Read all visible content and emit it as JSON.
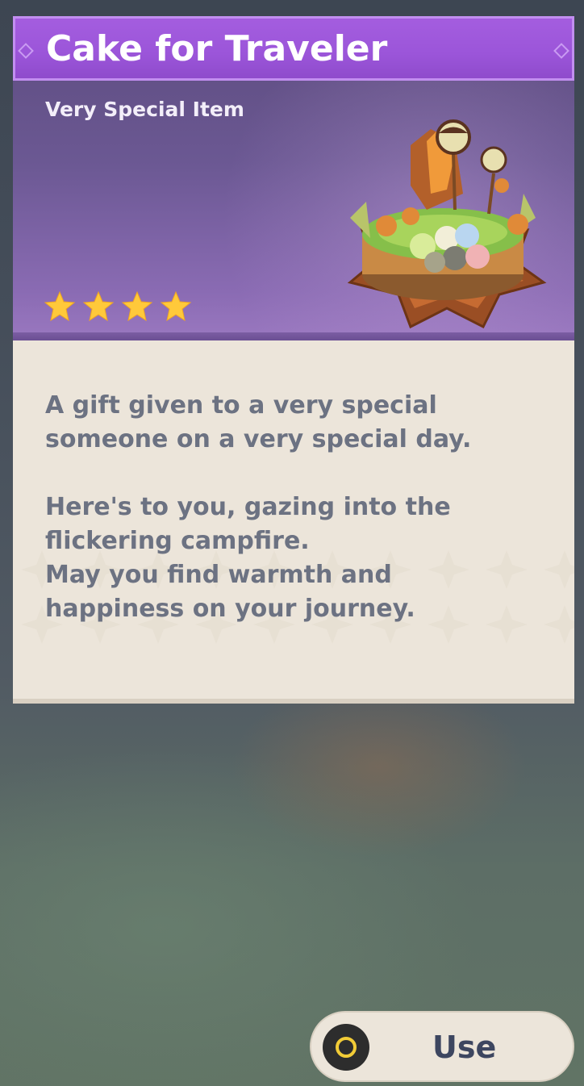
{
  "item": {
    "name": "Cake for Traveler",
    "type": "Very Special Item",
    "rarity_stars": 4,
    "description_paragraphs": [
      "A gift given to a very special\nsomeone on a very special day.",
      "Here's to you, gazing into the\nflickering campfire.\nMay you find warmth and\nhappiness on your journey."
    ]
  },
  "action": {
    "use_label": "Use",
    "use_icon": "controller-o-button-icon"
  },
  "icons": {
    "item_image": "cake-icon",
    "rarity": "star-icon"
  },
  "colors": {
    "title_bar": "#9b55d9",
    "header": "#6b5893",
    "body_panel": "#ece5da",
    "star": "#ffc93a",
    "description_text": "#6c7282",
    "button_label": "#3d4660",
    "button_ring": "#f2cc37"
  }
}
